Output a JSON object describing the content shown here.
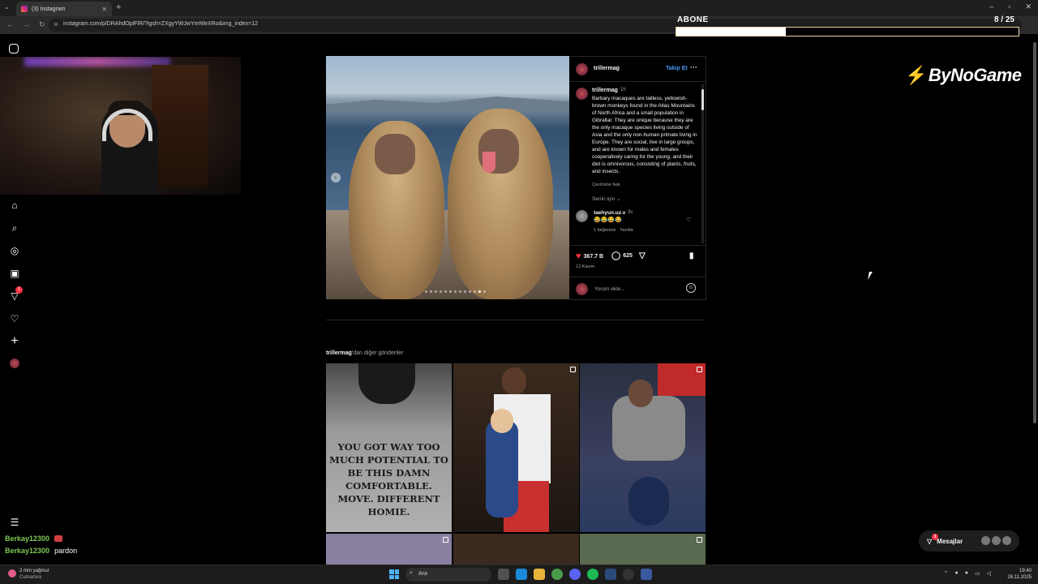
{
  "browser": {
    "tab_title": "(3) Instagram",
    "url": "instagram.com/p/DRAhdOpiFlR/?igsh=ZXgyYWJwYmNleXRo&img_index=12"
  },
  "overlay": {
    "abone_label": "ABONE",
    "abone_count": "8 / 25",
    "abone_progress": 0.32,
    "logo": "ByNoGame"
  },
  "sidebar": {
    "icons": [
      "instagram-logo-icon",
      "home-icon",
      "search-icon",
      "explore-icon",
      "reels-icon",
      "messages-icon",
      "heart-icon",
      "create-icon",
      "profile-icon",
      "menu-icon"
    ],
    "messages_badge": "1"
  },
  "post": {
    "username": "trillermag",
    "follow_label": "Takip Et",
    "caption_time": "1h",
    "caption": "Barbary macaques are tailless, yellowish-brown monkeys found in the Atlas Mountains of North Africa and a small population in Gibraltar. They are unique because they are the only macaque species living outside of Asia and the only non-human primate living in Europe. They are social, live in large groups, and are known for males and females cooperatively caring for the young, and their diet is omnivorous, consisting of plants, fruits, and insects.",
    "translate_label": "Çevirisine bak",
    "for_you_label": "Senin için",
    "comment": {
      "username": "taehyun.uz.v",
      "time": "3s",
      "text": "😂😂😂😂",
      "likes_label": "1 beğenme",
      "reply_label": "Yanıtla"
    },
    "like_count": "367.7 B",
    "comment_count": "625",
    "date": "13 Kasım",
    "add_comment_placeholder": "Yorum ekle...",
    "carousel_current": 12
  },
  "more_posts": {
    "username": "trillermag",
    "suffix": "'dan diğer gönderiler",
    "shirt_text": "YOU GOT WAY TOO MUCH POTENTIAL TO BE THIS DAMN COMFORTABLE. MOVE. DIFFERENT HOMIE."
  },
  "messages_button": {
    "label": "Mesajlar",
    "badge": "3"
  },
  "chat": [
    {
      "user": "Berkay12300",
      "text": ""
    },
    {
      "user": "Berkay12300",
      "text": "pardon"
    }
  ],
  "taskbar": {
    "weather_temp": "2 mm yağmur",
    "weather_day": "Cumartesi",
    "search_label": "Ara",
    "time": "19:40",
    "date": "26.11.2025"
  }
}
